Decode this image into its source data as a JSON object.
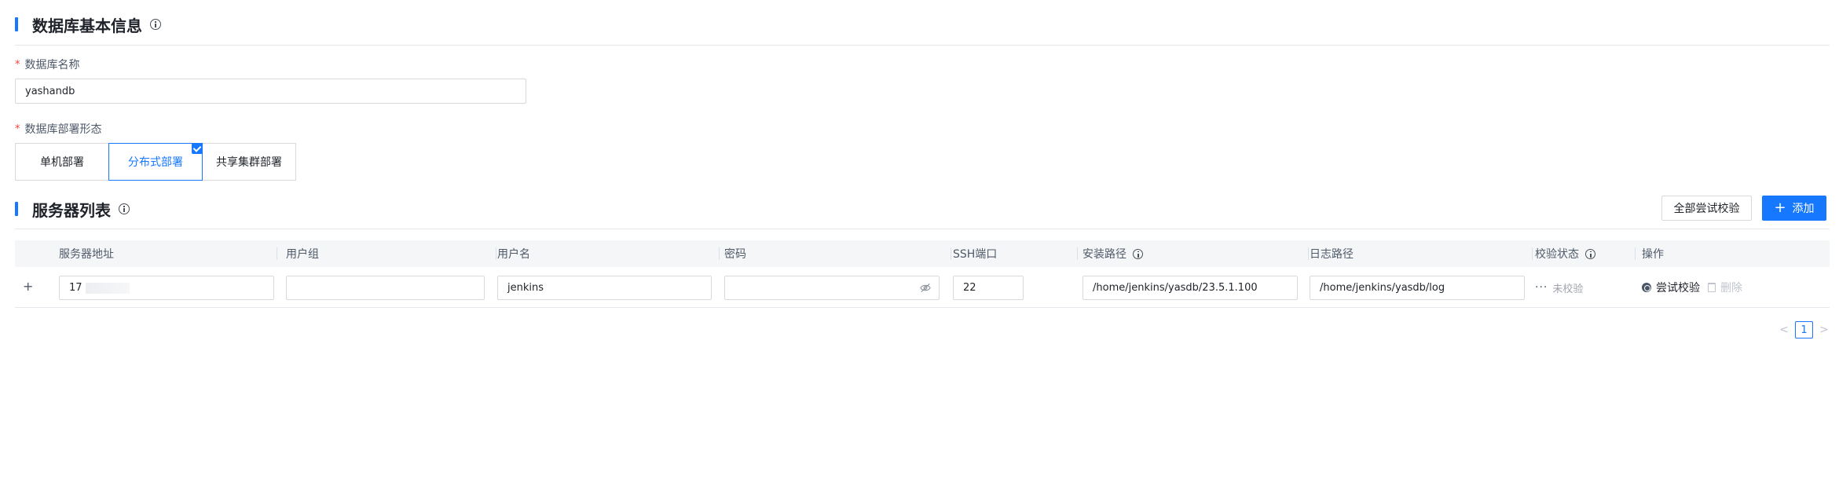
{
  "basic_info": {
    "title": "数据库基本信息",
    "name_label": "数据库名称",
    "name_value": "yashandb",
    "deploy_label": "数据库部署形态",
    "deploy_options": [
      "单机部署",
      "分布式部署",
      "共享集群部署"
    ],
    "deploy_selected": "分布式部署",
    "required_mark": "*"
  },
  "server_list": {
    "title": "服务器列表",
    "verify_all_label": "全部尝试校验",
    "add_label": "添加",
    "add_icon": "+",
    "columns": [
      "服务器地址",
      "用户组",
      "用户名",
      "密码",
      "SSH端口",
      "安装路径",
      "日志路径",
      "校验状态",
      "操作"
    ],
    "rows": [
      {
        "expand": "+",
        "address": "17",
        "group": "",
        "username": "jenkins",
        "password": "",
        "ssh_port": "22",
        "install_path": "/home/jenkins/yasdb/23.5.1.100",
        "log_path": "/home/jenkins/yasdb/log",
        "status_dots": "···",
        "status": "未校验",
        "action_verify": "尝试校验",
        "action_delete": "删除"
      }
    ]
  },
  "pagination": {
    "prev": "<",
    "current": "1",
    "next": ">"
  },
  "colors": {
    "accent": "#1677ff",
    "required": "#f53f3f",
    "header_bg": "#f5f6f8"
  }
}
